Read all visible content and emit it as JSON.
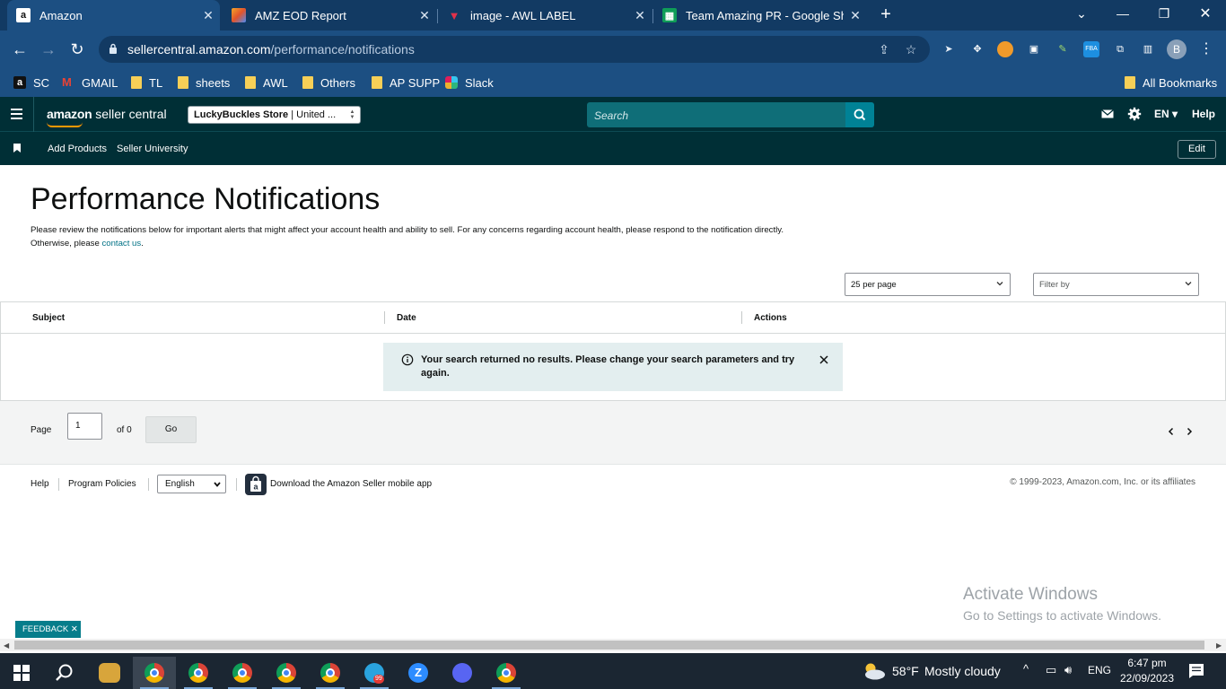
{
  "browser": {
    "tabs": [
      {
        "title": "Amazon",
        "favicon": "amazon-icon",
        "active": true
      },
      {
        "title": "AMZ EOD Report",
        "favicon": "app-icon",
        "active": false
      },
      {
        "title": "image - AWL LABEL",
        "favicon": "awl-icon",
        "active": false
      },
      {
        "title": "Team Amazing PR - Google Shee",
        "favicon": "sheets-icon",
        "active": false
      }
    ],
    "url_host": "sellercentral.amazon.com",
    "url_path": "/performance/notifications",
    "profile_initial": "B",
    "bookmarks": [
      {
        "label": "SC",
        "icon": "amazon-icon"
      },
      {
        "label": "GMAIL",
        "icon": "gmail-icon"
      },
      {
        "label": "TL",
        "icon": "folder-icon"
      },
      {
        "label": "sheets",
        "icon": "folder-icon"
      },
      {
        "label": "AWL",
        "icon": "folder-icon"
      },
      {
        "label": "Others",
        "icon": "folder-icon"
      },
      {
        "label": "AP SUPP",
        "icon": "folder-icon"
      },
      {
        "label": "Slack",
        "icon": "slack-icon"
      }
    ],
    "all_bookmarks": "All Bookmarks",
    "extensions": [
      {
        "label": "FBA"
      }
    ]
  },
  "header": {
    "logo_brand": "amazon",
    "logo_suffix": "seller central",
    "store_name": "LuckyBuckles Store",
    "store_region": " | United ...",
    "search_placeholder": "Search",
    "language": "EN",
    "help": "Help"
  },
  "subnav": {
    "links": [
      "Add Products",
      "Seller University"
    ],
    "edit": "Edit"
  },
  "main": {
    "title": "Performance Notifications",
    "description": "Please review the notifications below for important alerts that might affect your account health and ability to sell. For any concerns regarding account health, please respond to the notification directly. Otherwise, please ",
    "contact_link": "contact us",
    "description_end": ".",
    "per_page": "25 per page",
    "filter_placeholder": "Filter by",
    "columns": [
      "Subject",
      "Date",
      "Actions"
    ],
    "alert_message": "Your search returned no results. Please change your search parameters and try again.",
    "page_label": "Page",
    "page_value": "1",
    "of_label": "of 0",
    "go_label": "Go"
  },
  "footer": {
    "help": "Help",
    "program_policies": "Program Policies",
    "language": "English",
    "download_app": "Download the Amazon Seller mobile app",
    "copyright": "© 1999-2023, Amazon.com, Inc. or its affiliates"
  },
  "overlay": {
    "activate_title": "Activate Windows",
    "activate_sub": "Go to Settings to activate Windows.",
    "feedback": "FEEDBACK ✕"
  },
  "taskbar": {
    "weather_temp": "58°F",
    "weather_desc": "Mostly cloudy",
    "lang": "ENG",
    "time": "6:47 pm",
    "date": "22/09/2023",
    "telegram_badge": "99"
  }
}
